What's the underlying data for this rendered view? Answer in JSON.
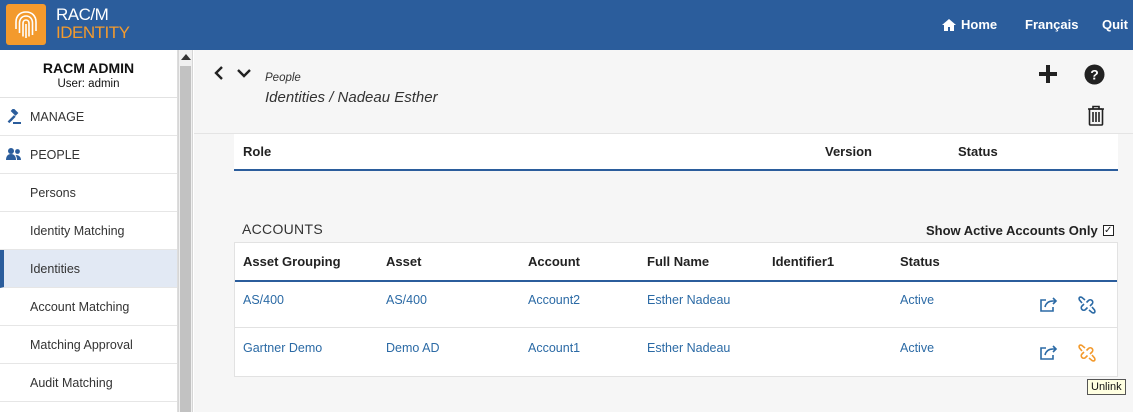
{
  "app": {
    "logo_line1": "RAC/M",
    "logo_line2": "IDENTITY"
  },
  "topnav": {
    "home": "Home",
    "language": "Français",
    "quit": "Quit"
  },
  "sidebar": {
    "title": "RACM ADMIN",
    "user": "User: admin",
    "sections": {
      "manage": "MANAGE",
      "people": "PEOPLE"
    },
    "items": [
      "Persons",
      "Identity Matching",
      "Identities",
      "Account Matching",
      "Matching Approval",
      "Audit Matching"
    ],
    "active": "Identities"
  },
  "breadcrumb": {
    "section": "People",
    "path": "Identities / Nadeau Esther"
  },
  "roles_table": {
    "headers": {
      "role": "Role",
      "version": "Version",
      "status": "Status"
    }
  },
  "accounts": {
    "title": "ACCOUNTS",
    "show_active_label": "Show Active Accounts Only",
    "show_active_checked": true,
    "headers": {
      "asset_grouping": "Asset Grouping",
      "asset": "Asset",
      "account": "Account",
      "full_name": "Full Name",
      "identifier1": "Identifier1",
      "status": "Status"
    },
    "rows": [
      {
        "asset_grouping": "AS/400",
        "asset": "AS/400",
        "account": "Account2",
        "full_name": "Esther Nadeau",
        "identifier1": "",
        "status": "Active"
      },
      {
        "asset_grouping": "Gartner Demo",
        "asset": "Demo AD",
        "account": "Account1",
        "full_name": "Esther Nadeau",
        "identifier1": "",
        "status": "Active"
      }
    ]
  },
  "tooltip": "Unlink",
  "colors": {
    "header_bg": "#2b5d9c",
    "accent": "#f39a2d",
    "link": "#2b6aa5"
  }
}
